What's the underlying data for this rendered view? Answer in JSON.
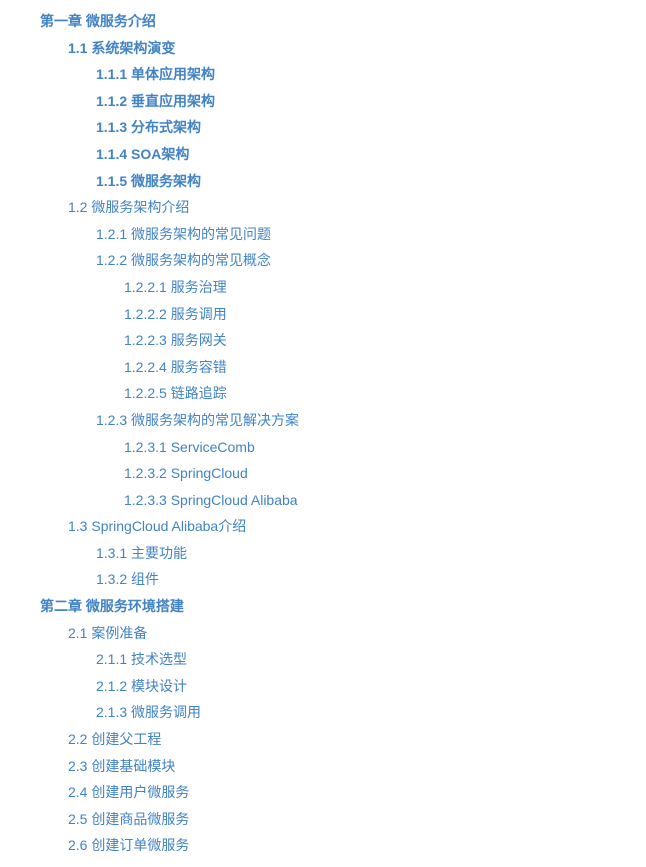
{
  "toc": [
    {
      "level": 1,
      "bold": true,
      "label": "第一章 微服务介绍"
    },
    {
      "level": 2,
      "bold": true,
      "label": "1.1 系统架构演变"
    },
    {
      "level": 3,
      "bold": true,
      "label": "1.1.1 单体应用架构"
    },
    {
      "level": 3,
      "bold": true,
      "label": "1.1.2 垂直应用架构"
    },
    {
      "level": 3,
      "bold": true,
      "label": "1.1.3 分布式架构"
    },
    {
      "level": 3,
      "bold": true,
      "label": "1.1.4 SOA架构"
    },
    {
      "level": 3,
      "bold": true,
      "label": "1.1.5 微服务架构"
    },
    {
      "level": 2,
      "bold": false,
      "label": "1.2 微服务架构介绍"
    },
    {
      "level": 3,
      "bold": false,
      "label": "1.2.1 微服务架构的常见问题"
    },
    {
      "level": 3,
      "bold": false,
      "label": "1.2.2 微服务架构的常见概念"
    },
    {
      "level": 4,
      "bold": false,
      "label": "1.2.2.1 服务治理"
    },
    {
      "level": 4,
      "bold": false,
      "label": "1.2.2.2 服务调用"
    },
    {
      "level": 4,
      "bold": false,
      "label": "1.2.2.3 服务网关"
    },
    {
      "level": 4,
      "bold": false,
      "label": "1.2.2.4 服务容错"
    },
    {
      "level": 4,
      "bold": false,
      "label": "1.2.2.5 链路追踪"
    },
    {
      "level": 3,
      "bold": false,
      "label": "1.2.3 微服务架构的常见解决方案"
    },
    {
      "level": 4,
      "bold": false,
      "label": "1.2.3.1 ServiceComb"
    },
    {
      "level": 4,
      "bold": false,
      "label": "1.2.3.2 SpringCloud"
    },
    {
      "level": 4,
      "bold": false,
      "label": "1.2.3.3 SpringCloud Alibaba"
    },
    {
      "level": 2,
      "bold": false,
      "label": "1.3 SpringCloud Alibaba介绍"
    },
    {
      "level": 3,
      "bold": false,
      "label": "1.3.1 主要功能"
    },
    {
      "level": 3,
      "bold": false,
      "label": "1.3.2 组件"
    },
    {
      "level": 1,
      "bold": true,
      "label": "第二章 微服务环境搭建"
    },
    {
      "level": 2,
      "bold": false,
      "label": "2.1 案例准备"
    },
    {
      "level": 3,
      "bold": false,
      "label": "2.1.1 技术选型"
    },
    {
      "level": 3,
      "bold": false,
      "label": "2.1.2 模块设计"
    },
    {
      "level": 3,
      "bold": false,
      "label": "2.1.3 微服务调用"
    },
    {
      "level": 2,
      "bold": false,
      "label": "2.2 创建父工程"
    },
    {
      "level": 2,
      "bold": false,
      "label": "2.3 创建基础模块"
    },
    {
      "level": 2,
      "bold": false,
      "label": "2.4 创建用户微服务"
    },
    {
      "level": 2,
      "bold": false,
      "label": "2.5 创建商品微服务"
    },
    {
      "level": 2,
      "bold": false,
      "label": "2.6 创建订单微服务"
    }
  ]
}
